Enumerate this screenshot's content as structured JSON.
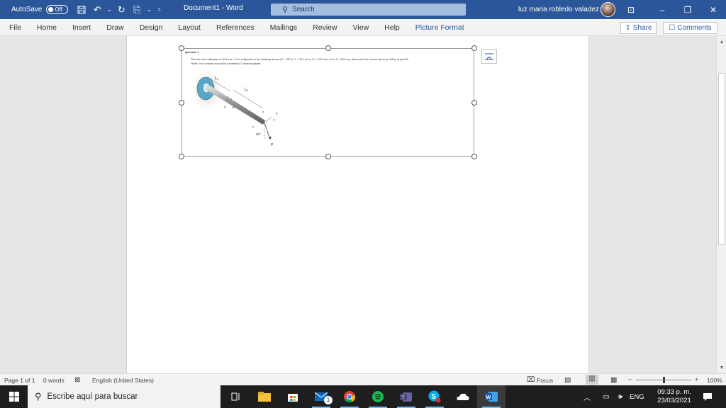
{
  "titlebar": {
    "autosave_label": "AutoSave",
    "autosave_state": "Off",
    "document_title": "Document1 - Word",
    "search_placeholder": "Search",
    "user_name": "luz maria robledo valadez",
    "bg_color": "#2b579a"
  },
  "menu": {
    "items": [
      "File",
      "Home",
      "Insert",
      "Draw",
      "Design",
      "Layout",
      "References",
      "Mailings",
      "Review",
      "View",
      "Help",
      "Picture Format"
    ],
    "active": "Picture Format",
    "share_label": "Share",
    "comments_label": "Comments"
  },
  "document": {
    "question_title": "Question 1",
    "question_text": "The bar has a diameter of 30.6 mm. If it is subjected to the loadings shown (P = 957 N, T = 31.1 N·m, L1 = 227 mm, and L2 = 183 mm, determine the normal stress (in MPa) at point B.",
    "note": "*Note: Your answer should be rounded to 2 decimal places.",
    "diagram_labels": {
      "l2": "L₂",
      "l1": "L₁",
      "a": "A",
      "b": "B",
      "t": "T",
      "angle": "30°",
      "p": "P",
      "x": "x",
      "y": "y",
      "z": "z"
    }
  },
  "statusbar": {
    "page": "Page 1 of 1",
    "words": "0 words",
    "language": "English (United States)",
    "focus": "Focus",
    "zoom": "100%",
    "zoom_minus": "–",
    "zoom_plus": "+"
  },
  "taskbar": {
    "search_placeholder": "Escribe aquí para buscar",
    "lang": "ENG",
    "time": "09:33 p. m.",
    "date": "23/03/2021",
    "mail_badge": "1"
  }
}
